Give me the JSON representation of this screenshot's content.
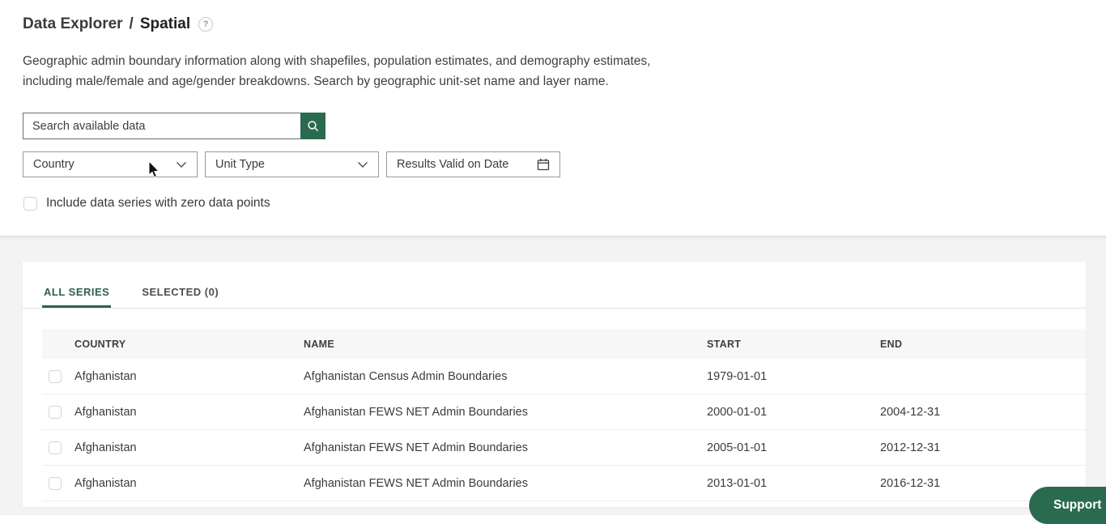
{
  "colors": {
    "accent_green": "#2a6b4f",
    "tab_active_green": "#2e5f50",
    "lower_background": "#f3f3f3"
  },
  "header": {
    "breadcrumb_root": "Data Explorer",
    "breadcrumb_separator": "/",
    "breadcrumb_current": "Spatial",
    "help_icon_glyph": "?",
    "description_line1": "Geographic admin boundary information along with shapefiles, population estimates, and demography estimates,",
    "description_line2": "including male/female and age/gender breakdowns. Search by geographic unit-set name and layer name."
  },
  "filters": {
    "search": {
      "placeholder": "Search available data"
    },
    "country_dropdown": {
      "label": "Country"
    },
    "unit_type_dropdown": {
      "label": "Unit Type"
    },
    "date_picker": {
      "label": "Results Valid on Date"
    },
    "zero_data_checkbox": {
      "label": "Include data series with zero data points",
      "checked": false
    }
  },
  "results": {
    "tabs": [
      {
        "label": "ALL SERIES",
        "active": true
      },
      {
        "label": "SELECTED (0)",
        "active": false
      }
    ],
    "table": {
      "columns": [
        "COUNTRY",
        "NAME",
        "START",
        "END"
      ],
      "rows": [
        {
          "country": "Afghanistan",
          "name": "Afghanistan Census Admin Boundaries",
          "start": "1979-01-01",
          "end": ""
        },
        {
          "country": "Afghanistan",
          "name": "Afghanistan FEWS NET Admin Boundaries",
          "start": "2000-01-01",
          "end": "2004-12-31"
        },
        {
          "country": "Afghanistan",
          "name": "Afghanistan FEWS NET Admin Boundaries",
          "start": "2005-01-01",
          "end": "2012-12-31"
        },
        {
          "country": "Afghanistan",
          "name": "Afghanistan FEWS NET Admin Boundaries",
          "start": "2013-01-01",
          "end": "2016-12-31"
        }
      ]
    }
  },
  "support": {
    "label": "Support"
  }
}
